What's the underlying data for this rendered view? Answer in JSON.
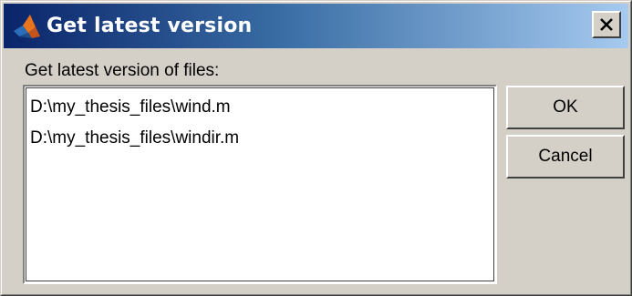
{
  "window": {
    "title": "Get latest version",
    "close_icon": "close-x-icon",
    "app_icon": "matlab-logo-icon"
  },
  "dialog": {
    "prompt": "Get latest version of files:",
    "files": [
      "D:\\my_thesis_files\\wind.m",
      "D:\\my_thesis_files\\windir.m"
    ],
    "buttons": {
      "ok_label": "OK",
      "cancel_label": "Cancel"
    }
  },
  "colors": {
    "titlebar_start": "#0a246a",
    "titlebar_end": "#a6caf0",
    "face": "#d4d0c8"
  }
}
